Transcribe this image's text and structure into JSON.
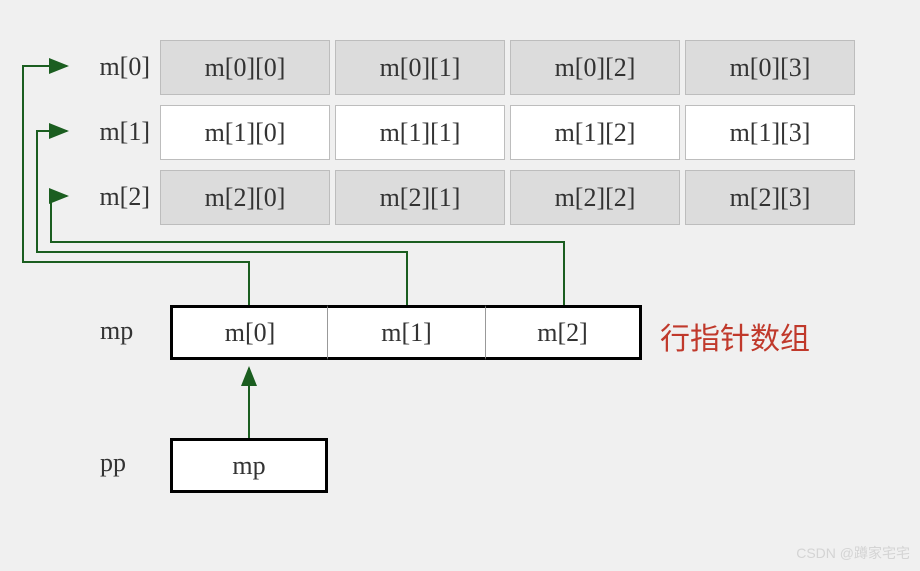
{
  "matrix": {
    "labels": [
      "m[0]",
      "m[1]",
      "m[2]"
    ],
    "rows": [
      [
        "m[0][0]",
        "m[0][1]",
        "m[0][2]",
        "m[0][3]"
      ],
      [
        "m[1][0]",
        "m[1][1]",
        "m[1][2]",
        "m[1][3]"
      ],
      [
        "m[2][0]",
        "m[2][1]",
        "m[2][2]",
        "m[2][3]"
      ]
    ]
  },
  "mp": {
    "label": "mp",
    "cells": [
      "m[0]",
      "m[1]",
      "m[2]"
    ],
    "annotation": "行指针数组"
  },
  "pp": {
    "label": "pp",
    "value": "mp"
  },
  "watermark": "CSDN @蹲家宅宅",
  "chart_data": {
    "type": "diagram",
    "description": "C 2D array m[3][4]. mp is an array of 3 row pointers (m[0], m[1], m[2]). pp is a pointer to mp. Arrows from mp[i] to m[i], arrow from pp to mp.",
    "m_dims": [
      3,
      4
    ],
    "mp_points_to": [
      "m[0]",
      "m[1]",
      "m[2]"
    ],
    "pp_points_to": "mp",
    "annotation_translation": "row pointer array"
  }
}
